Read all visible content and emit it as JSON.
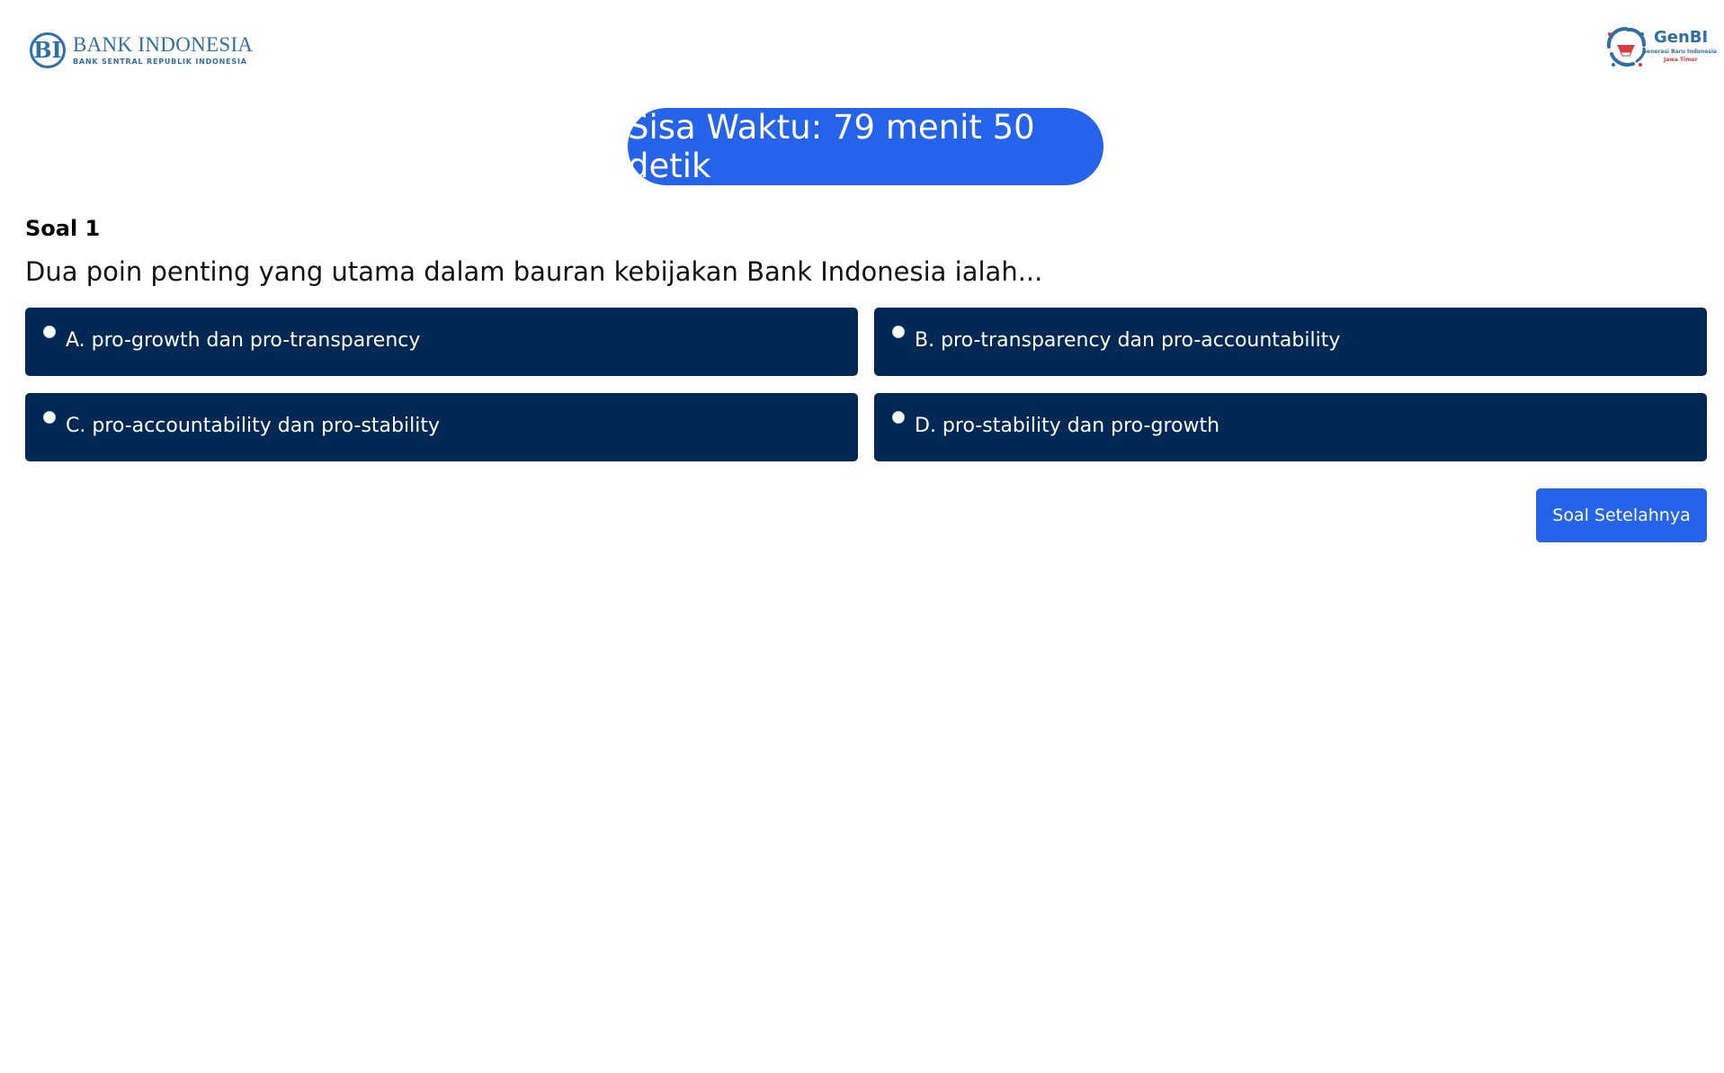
{
  "header": {
    "bi_logo": {
      "emblem": "BI",
      "name": "BANK INDONESIA",
      "subtitle": "BANK SENTRAL REPUBLIK INDONESIA"
    },
    "genbi_logo": {
      "title": "GenBI",
      "tagline": "Generasi Baru Indonesia",
      "region": "Jawa Timur"
    }
  },
  "timer": {
    "label": "Sisa Waktu: 79 menit 50 detik"
  },
  "question": {
    "number_label": "Soal 1",
    "text": "Dua poin penting yang utama dalam bauran kebijakan Bank Indonesia ialah..."
  },
  "options": [
    {
      "label": "A. pro-growth dan pro-transparency",
      "selected": false
    },
    {
      "label": "B. pro-transparency dan pro-accountability",
      "selected": false
    },
    {
      "label": "C. pro-accountability dan pro-stability",
      "selected": false
    },
    {
      "label": "D. pro-stability dan pro-growth",
      "selected": false
    }
  ],
  "navigation": {
    "next_label": "Soal Setelahnya"
  },
  "colors": {
    "primary_blue": "#2563eb",
    "option_navy": "#002855",
    "bi_logo_blue": "#2f6fa8",
    "genbi_red": "#d93a3a"
  }
}
